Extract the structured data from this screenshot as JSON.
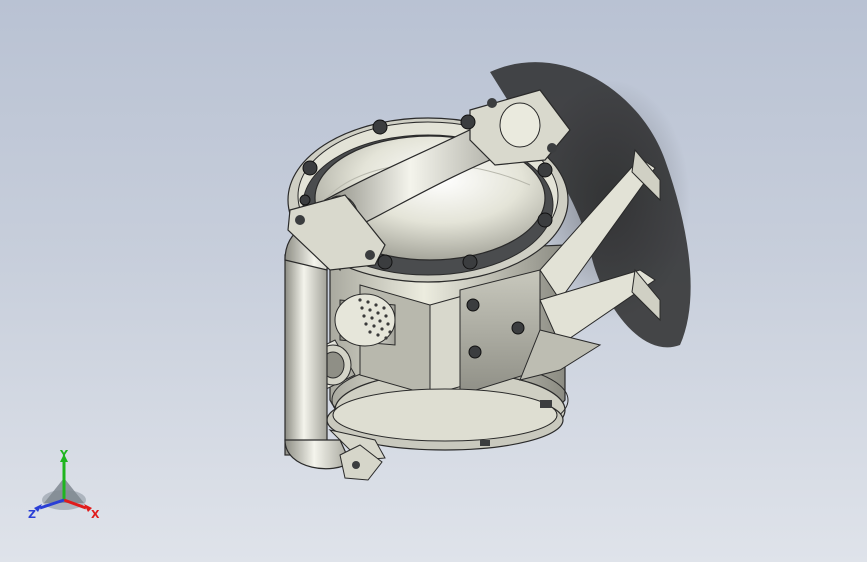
{
  "viewport": {
    "background_top": "#b9c2d3",
    "background_bottom": "#dfe3ea"
  },
  "model": {
    "render_style": "shaded-with-edges",
    "body_color": "#dcdcd0",
    "edge_color": "#2a2a2a",
    "bolt_color": "#3b3d3f"
  },
  "triad": {
    "x_label": "X",
    "y_label": "Y",
    "z_label": "Z",
    "x_color": "#e01b1b",
    "y_color": "#1fb51f",
    "z_color": "#2a3fd6"
  }
}
